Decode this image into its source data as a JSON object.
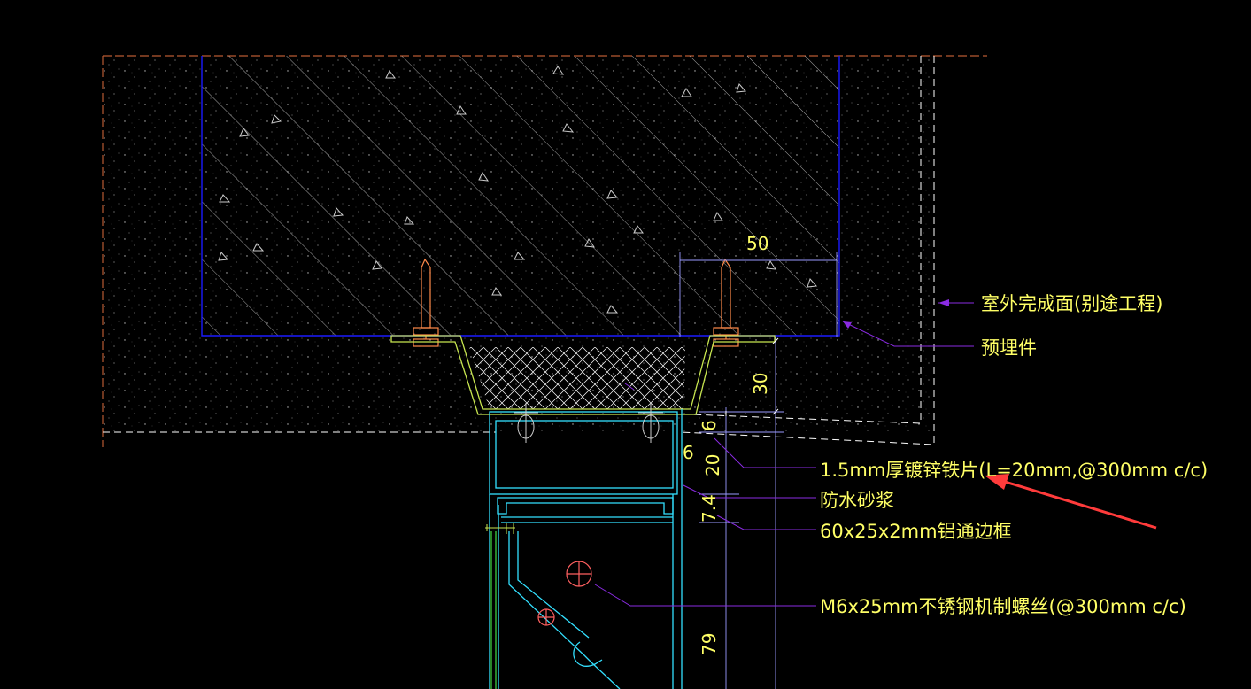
{
  "colors": {
    "background": "#000000",
    "concrete_outline": "#1a1aff",
    "hatch": "#ffffff",
    "dim": "#c8c8ff",
    "text": "#ffff66",
    "leader": "#8a2be2",
    "aluminum": "#33e0ff",
    "bracket": "#c8e650",
    "anchor": "#ff8a4a",
    "arrow": "#ff3b3b",
    "green": "#44dd44",
    "dashed": "#ffffff",
    "brown": "#b85a32"
  },
  "dimensions": {
    "d50": "50",
    "d30": "30",
    "d6_top": "6",
    "d6": "6",
    "d20": "20",
    "d7_4": "7.4",
    "d79": "79"
  },
  "labels": {
    "finish_face": "室外完成面(别途工程)",
    "embedded_part": "预埋件",
    "galvanized_plate": "1.5mm厚镀锌铁片(L=20mm,@300mm c/c)",
    "waterproof_mortar": "防水砂浆",
    "aluminum_frame": "60x25x2mm铝通边框",
    "screw": "M6x25mm不锈钢机制螺丝(@300mm c/c)"
  }
}
